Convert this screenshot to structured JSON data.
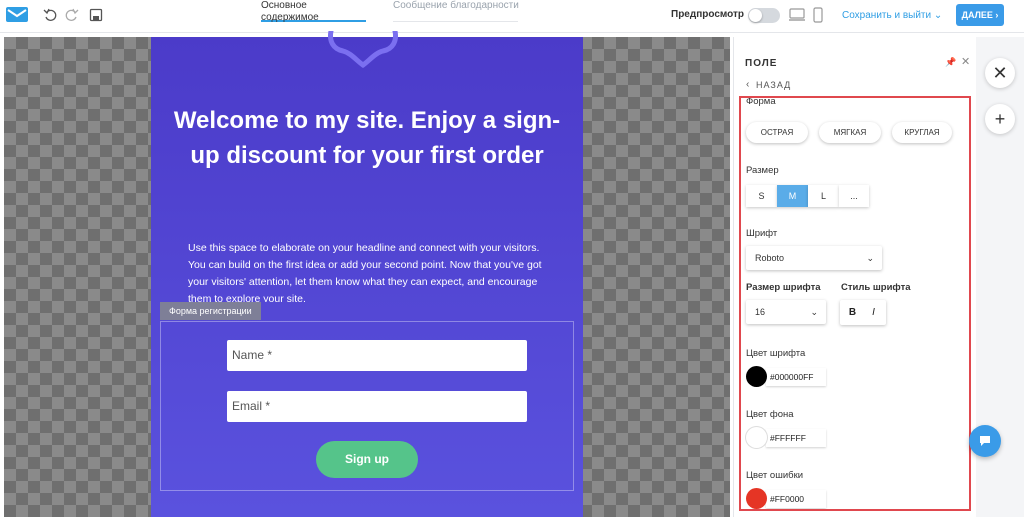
{
  "topbar": {
    "tabs": [
      "Основное содержимое",
      "Сообщение благодарности"
    ],
    "preview_label": "Предпросмотр",
    "save_exit_label": "Сохранить и выйти",
    "next_label": "ДАЛЕЕ",
    "accent_color": "#3a9be8"
  },
  "canvas": {
    "headline": "Welcome to my site. Enjoy a sign-up discount for your first order",
    "body_text": "Use this space to elaborate on your headline and connect with your visitors. You can build on the first idea or add your second point. Now that you've got your visitors' attention, let them know what they can expect, and encourage them to explore your site.",
    "form_tag": "Форма регистрации",
    "name_placeholder": "Name *",
    "email_placeholder": "Email *",
    "signup_label": "Sign up",
    "card_color": "#4b3bc9",
    "button_color": "#55c48a"
  },
  "panel": {
    "title": "ПОЛЕ",
    "back_label": "НАЗАД",
    "shape_label": "Форма",
    "shapes": [
      "ОСТРАЯ",
      "МЯГКАЯ",
      "КРУГЛАЯ"
    ],
    "size_label": "Размер",
    "sizes": [
      "S",
      "M",
      "L",
      "..."
    ],
    "selected_size": "M",
    "font_label": "Шрифт",
    "font_value": "Roboto",
    "font_size_label": "Размер шрифта",
    "font_size_value": "16",
    "font_style_label": "Стиль шрифта",
    "bold_label": "B",
    "italic_label": "I",
    "font_color_label": "Цвет шрифта",
    "font_color_value": "#000000FF",
    "bg_color_label": "Цвет фона",
    "bg_color_value": "#FFFFFF",
    "error_color_label": "Цвет ошибки",
    "error_color_value": "#FF0000",
    "highlight_color": "#e0484e"
  }
}
